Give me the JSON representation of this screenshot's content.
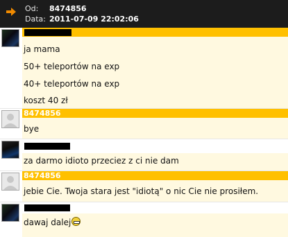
{
  "header": {
    "from_label": "Od:",
    "from_value": "8474856",
    "date_label": "Data:",
    "date_value": "2011-07-09 22:02:06"
  },
  "messages": [
    {
      "author": "",
      "avatar": "dark",
      "lines": [
        "ja mama",
        "50+ teleportów na exp",
        "40+ teleportów na exp",
        "koszt 40 zł"
      ]
    },
    {
      "author": "8474856",
      "avatar": "default",
      "lines": [
        "bye"
      ]
    },
    {
      "author": "",
      "avatar": "dark",
      "lines": [
        "za darmo idioto przeciez z ci nie dam"
      ]
    },
    {
      "author": "8474856",
      "avatar": "default",
      "lines": [
        "jebie Cie. Twoja stara jest \"idiotą\" o nic Cie nie prosiłem."
      ]
    },
    {
      "author": "",
      "avatar": "dark",
      "lines": [
        "dawaj dalej"
      ],
      "emoji": "grin-emoji"
    }
  ],
  "colors": {
    "header_bg": "#1c1c1c",
    "accent": "#ffc000",
    "body_bg": "#fff9e0",
    "arrow": "#f08a00"
  }
}
